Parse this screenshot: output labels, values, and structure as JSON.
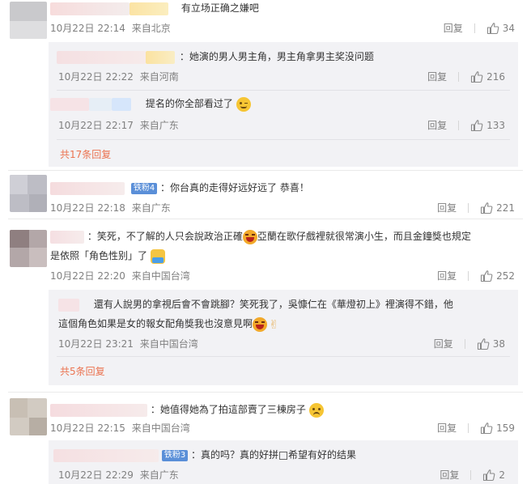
{
  "comments": [
    {
      "text": "有立场正确之嫌吧",
      "time": "10月22日 22:14",
      "location": "来自北京",
      "reply_label": "回复",
      "likes": "34",
      "replies": [
        {
          "text": "：她演的男人男主角，男主角拿男主奖没问题",
          "time": "10月22日 22:22",
          "location": "来自河南",
          "reply_label": "回复",
          "likes": "216"
        },
        {
          "text": "提名的你全部看过了",
          "time": "10月22日 22:17",
          "location": "来自广东",
          "reply_label": "回复",
          "likes": "133"
        }
      ],
      "more_replies": "共17条回复"
    },
    {
      "badge": "铁粉4",
      "text": "：你台真的走得好远好远了 恭喜！",
      "time": "10月22日 22:18",
      "location": "来自广东",
      "reply_label": "回复",
      "likes": "221"
    },
    {
      "text_line1_a": "：笑死，不了解的人只会說政治正確",
      "text_line1_b": "亞蘭在歌仔戲裡就很常演小生，而且金鐘獎也規定",
      "text_line2_a": "是依照「角色性别」了",
      "time": "10月22日 22:20",
      "location": "来自中国台湾",
      "reply_label": "回复",
      "likes": "252",
      "replies": [
        {
          "text_line1": "還有人說男的拿視后會不會跳腳？笑死我了，吳慷仁在《華燈初上》裡演得不錯，他",
          "text_line2": "這個角色如果是女的報女配角獎我也沒意見啊",
          "time": "10月22日 23:21",
          "location": "来自中国台湾",
          "reply_label": "回复",
          "likes": "38"
        }
      ],
      "more_replies": "共5条回复"
    },
    {
      "text": "：她值得她為了拍這部賣了三棟房子",
      "time": "10月22日 22:15",
      "location": "来自中国台湾",
      "reply_label": "回复",
      "likes": "159",
      "replies": [
        {
          "badge": "铁粉3",
          "text": "：真的吗？真的好拼",
          "text_b": "希望有好的结果",
          "time": "10月22日 22:29",
          "location": "来自广东",
          "reply_label": "回复",
          "likes": "2"
        }
      ]
    }
  ]
}
